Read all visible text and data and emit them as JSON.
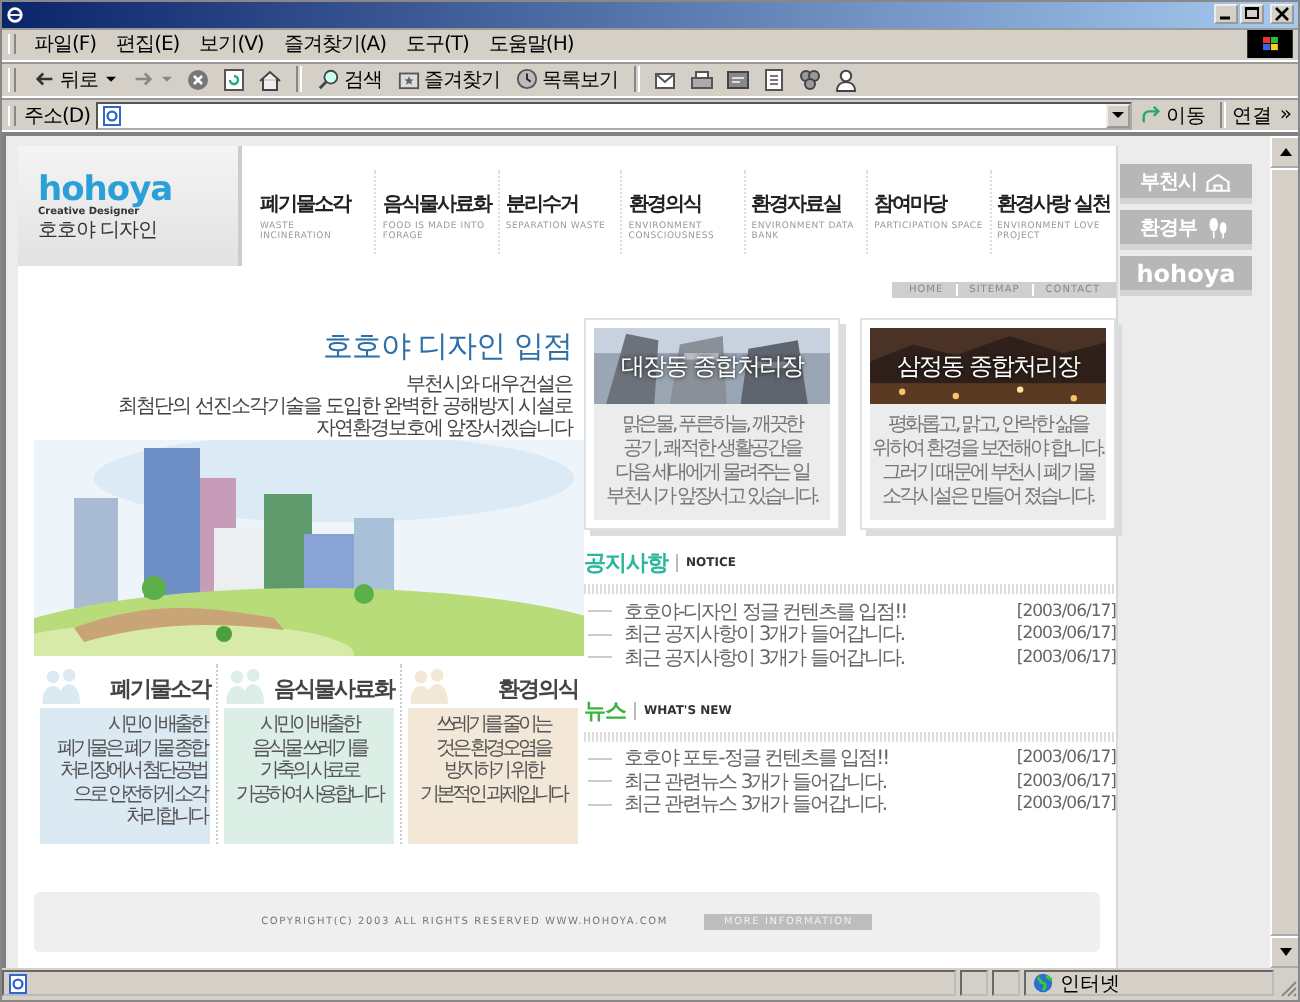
{
  "menu": [
    "파일(F)",
    "편집(E)",
    "보기(V)",
    "즐겨찾기(A)",
    "도구(T)",
    "도움말(H)"
  ],
  "toolbar": {
    "back": "뒤로",
    "search": "검색",
    "favorites": "즐겨찾기",
    "history": "목록보기"
  },
  "address_bar": {
    "label": "주소(D)",
    "go": "이동",
    "links": "연결",
    "more": "»"
  },
  "site": {
    "logo": "hohoya",
    "logo_tagline": "Creative Designer",
    "logo_name": "호호야 디자인",
    "nav": [
      {
        "title": "폐기물소각",
        "subtitle": "WASTE INCINERATION"
      },
      {
        "title": "음식물사료화",
        "subtitle": "FOOD IS MADE INTO FORAGE"
      },
      {
        "title": "분리수거",
        "subtitle": "SEPARATION WASTE"
      },
      {
        "title": "환경의식",
        "subtitle": "ENVIRONMENT CONSCIOUSNESS"
      },
      {
        "title": "환경자료실",
        "subtitle": "ENVIRONMENT DATA BANK"
      },
      {
        "title": "참여마당",
        "subtitle": "PARTICIPATION SPACE"
      },
      {
        "title": "환경사랑 실천",
        "subtitle": "ENVIRONMENT LOVE PROJECT"
      }
    ],
    "utility_links": [
      "HOME",
      "SITEMAP",
      "CONTACT"
    ],
    "side_buttons": [
      {
        "kind": "city",
        "label": "부천시"
      },
      {
        "kind": "ministry",
        "label": "환경부"
      },
      {
        "kind": "logo",
        "label": "hohoya"
      }
    ],
    "hero": {
      "title": "호호야 디자인 입점",
      "lines": [
        "부천시와 대우건설은",
        "최첨단의 선진소각기술을 도입한 완벽한 공해방지 시설로",
        "자연환경보호에 앞장서겠습니다"
      ]
    },
    "cards": [
      {
        "kind": "day",
        "title": "대장동 종합처리장",
        "lines": [
          "맑은물, 푸른하늘, 깨끗한",
          "공기, 쾌적한 생활공간을",
          "다음 세대에게 물려주는 일",
          "부천시가 앞장서고 있습니다."
        ]
      },
      {
        "kind": "night",
        "title": "삼정동 종합처리장",
        "lines": [
          "평화롭고, 맑고, 안락한 삶을",
          "위하여 환경을 보전해야 합니다.",
          "그러기 때문에 부천시 폐기물",
          "소각시설은 만들어 졌습니다."
        ]
      }
    ],
    "features": [
      {
        "title": "폐기물소각",
        "color": "#dbe9f2",
        "lines": [
          "시민이 배출한",
          "폐기물은 폐기물 종합",
          "처리장에서 첨단공법",
          "으로 안전하게 소각",
          "처리합니다"
        ]
      },
      {
        "title": "음식물사료화",
        "color": "#dcefe6",
        "lines": [
          "시민이 배출한",
          "음식물 쓰레기를",
          "가축의 사료로",
          "가공하여 사용합니다"
        ]
      },
      {
        "title": "환경의식",
        "color": "#f3e8d8",
        "lines": [
          "쓰레기를 줄이는",
          "것은 환경오염을",
          "방지하기 위한",
          "기본적인 과제입니다"
        ]
      }
    ],
    "notice": {
      "title": "공지사항",
      "subtitle": "NOTICE",
      "items": [
        {
          "text": "호호야-디자인 정글 컨텐츠를 입점!!",
          "date": "[2003/06/17]"
        },
        {
          "text": "최근 공지사항이 3개가 들어갑니다.",
          "date": "[2003/06/17]"
        },
        {
          "text": "최근 공지사항이 3개가 들어갑니다.",
          "date": "[2003/06/17]"
        }
      ]
    },
    "news": {
      "title": "뉴스",
      "subtitle": "WHAT'S NEW",
      "items": [
        {
          "text": "호호야 포토-정글 컨텐츠를 입점!!",
          "date": "[2003/06/17]"
        },
        {
          "text": "최근 관련뉴스 3개가 들어갑니다.",
          "date": "[2003/06/17]"
        },
        {
          "text": "최근 관련뉴스 3개가 들어갑니다.",
          "date": "[2003/06/17]"
        }
      ]
    },
    "footer": {
      "copyright": "COPYRIGHT(C) 2003 ALL RIGHTS RESERVED WWW.HOHOYA.COM",
      "more": "MORE INFORMATION"
    }
  },
  "status_bar": {
    "zone": "인터넷"
  }
}
